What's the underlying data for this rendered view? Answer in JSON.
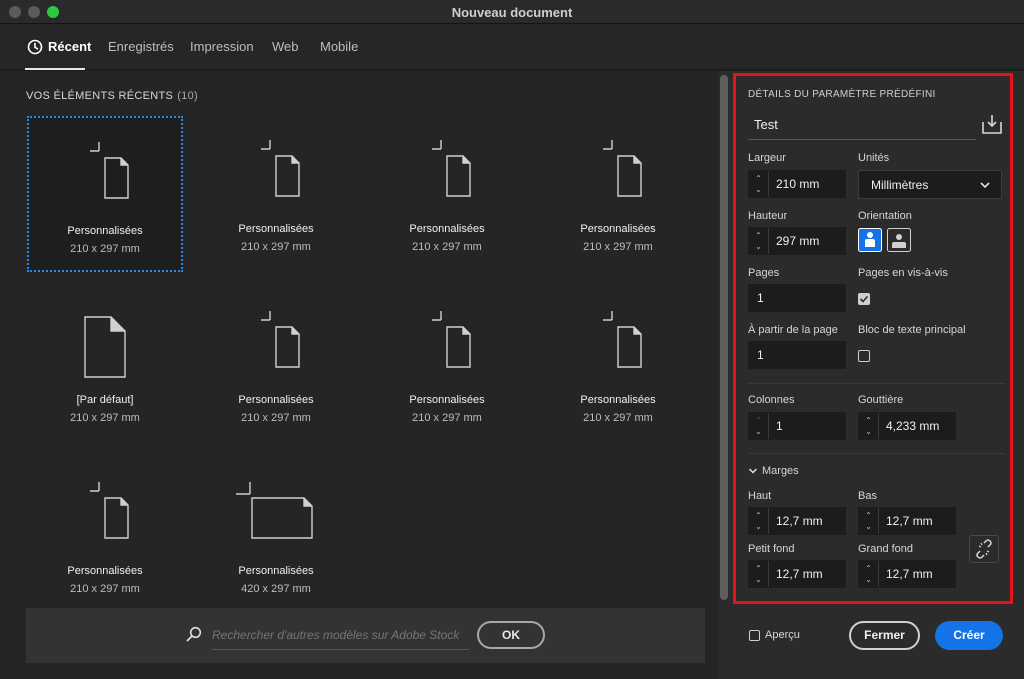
{
  "window": {
    "title": "Nouveau document"
  },
  "tabs": [
    {
      "label": "Récent"
    },
    {
      "label": "Enregistrés"
    },
    {
      "label": "Impression"
    },
    {
      "label": "Web"
    },
    {
      "label": "Mobile"
    }
  ],
  "recent": {
    "title": "VOS ÉLÉMENTS RÉCENTS",
    "count": "(10)",
    "items": [
      {
        "name": "Personnalisées",
        "size": "210 x 297 mm"
      },
      {
        "name": "Personnalisées",
        "size": "210 x 297 mm"
      },
      {
        "name": "Personnalisées",
        "size": "210 x 297 mm"
      },
      {
        "name": "Personnalisées",
        "size": "210 x 297 mm"
      },
      {
        "name": "[Par défaut]",
        "size": "210 x 297 mm"
      },
      {
        "name": "Personnalisées",
        "size": "210 x 297 mm"
      },
      {
        "name": "Personnalisées",
        "size": "210 x 297 mm"
      },
      {
        "name": "Personnalisées",
        "size": "210 x 297 mm"
      },
      {
        "name": "Personnalisées",
        "size": "210 x 297 mm"
      },
      {
        "name": "Personnalisées",
        "size": "420 x 297 mm"
      }
    ]
  },
  "search": {
    "placeholder": "Rechercher d'autres modèles sur Adobe Stock",
    "ok_label": "OK"
  },
  "details": {
    "heading": "DÉTAILS DU PARAMÈTRE PRÉDÉFINI",
    "preset_name": "Test",
    "width_label": "Largeur",
    "width_value": "210 mm",
    "units_label": "Unités",
    "units_value": "Millimètres",
    "height_label": "Hauteur",
    "height_value": "297 mm",
    "orientation_label": "Orientation",
    "pages_label": "Pages",
    "pages_value": "1",
    "facing_label": "Pages en vis-à-vis",
    "facing_checked": true,
    "start_label": "À partir de la page",
    "start_value": "1",
    "primary_text_label": "Bloc de texte principal",
    "primary_text_checked": false,
    "columns_label": "Colonnes",
    "columns_value": "1",
    "gutter_label": "Gouttière",
    "gutter_value": "4,233 mm",
    "margins_label": "Marges",
    "top_label": "Haut",
    "top_value": "12,7 mm",
    "bottom_label": "Bas",
    "bottom_value": "12,7 mm",
    "inside_label": "Petit fond",
    "inside_value": "12,7 mm",
    "outside_label": "Grand fond",
    "outside_value": "12,7 mm"
  },
  "footer": {
    "preview_label": "Aperçu",
    "close_label": "Fermer",
    "create_label": "Créer"
  },
  "colors": {
    "accent": "#1473e6",
    "selection": "#2d86e8",
    "highlight": "#e8121c"
  }
}
